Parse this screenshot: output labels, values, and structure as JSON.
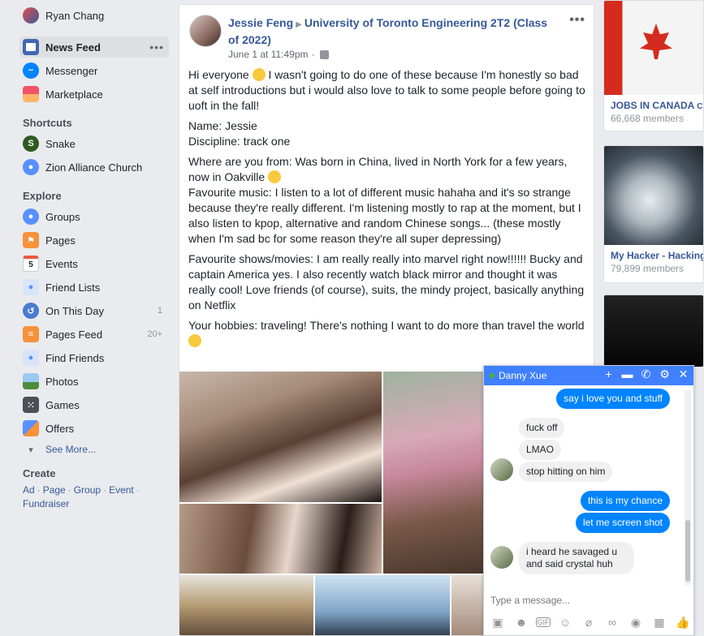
{
  "user": {
    "name": "Ryan Chang"
  },
  "nav": [
    {
      "label": "News Feed",
      "active": true,
      "more": "•••"
    },
    {
      "label": "Messenger"
    },
    {
      "label": "Marketplace"
    }
  ],
  "shortcuts": {
    "title": "Shortcuts",
    "items": [
      {
        "label": "Snake"
      },
      {
        "label": "Zion Alliance Church"
      }
    ]
  },
  "explore": {
    "title": "Explore",
    "items": [
      {
        "label": "Groups"
      },
      {
        "label": "Pages"
      },
      {
        "label": "Events",
        "icon_text": "5"
      },
      {
        "label": "Friend Lists"
      },
      {
        "label": "On This Day",
        "count": "1"
      },
      {
        "label": "Pages Feed",
        "count": "20+"
      },
      {
        "label": "Find Friends"
      },
      {
        "label": "Photos"
      },
      {
        "label": "Games"
      },
      {
        "label": "Offers"
      },
      {
        "label": "See More..."
      }
    ]
  },
  "create": {
    "title": "Create",
    "links": [
      "Ad",
      "Page",
      "Group",
      "Event",
      "Fundraiser"
    ]
  },
  "post": {
    "author": "Jessie Feng",
    "group": "University of Toronto Engineering 2T2 (Class of 2022)",
    "time": "June 1 at 11:49pm",
    "dot": "·",
    "more": "•••",
    "p1a": "Hi everyone",
    "p1b": "I wasn't going to do one of these because I'm honestly so bad at self introductions but i would also love to talk to some people before going to uoft in the fall!",
    "name_line": "Name: Jessie",
    "discipline_line": "Discipline: track one",
    "where_line": "Where are you from: Was born in China, lived in North York for a few years, now in Oakville",
    "music_line": "Favourite music: I listen to a lot of different music hahaha and it's so strange because they're really different. I'm listening mostly to rap at the moment, but I also listen to kpop, alternative and random Chinese songs... (these mostly when I'm sad bc for some reason they're all super depressing)",
    "shows_line": "Favourite shows/movies: I am really really into marvel right now!!!!!! Bucky and captain America yes. I also recently watch black mirror and thought it was really cool! Love friends (of course), suits, the mindy project, basically anything on Netflix",
    "hobbies_line": "Your hobbies: traveling! There's nothing I want to do more than travel the world"
  },
  "ads": [
    {
      "name": "JOBS IN CANADA",
      "suffix": "CA",
      "members": "66,668 members"
    },
    {
      "name": "My Hacker - Hacking",
      "members": "79,899 members"
    }
  ],
  "chat": {
    "contact": "Danny Xue",
    "messages": [
      {
        "from": "me",
        "text": "say i love you and stuff"
      },
      {
        "from": "them",
        "text": "fuck off"
      },
      {
        "from": "them",
        "text": "LMAO"
      },
      {
        "from": "them",
        "text": "stop hitting on him"
      },
      {
        "from": "me",
        "text": "this is my chance"
      },
      {
        "from": "me",
        "text": "let me screen shot"
      },
      {
        "from": "them",
        "text": "i heard he savaged u and said crystal huh"
      }
    ],
    "input_placeholder": "Type a message...",
    "tools": [
      "photo-icon",
      "sticker-icon",
      "gif-icon",
      "emoji-icon",
      "attach-icon",
      "link-icon",
      "camera-icon",
      "table-icon",
      "like-icon"
    ]
  },
  "colors": {
    "brand": "#4080ff",
    "link": "#365899",
    "bubble_me": "#0084ff",
    "bg": "#e9ebee"
  }
}
